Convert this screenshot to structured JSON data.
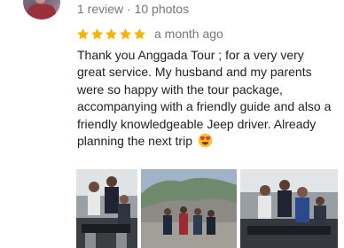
{
  "reviewer": {
    "avatar_icon": "user-avatar",
    "stats": "1 review · 10 photos"
  },
  "rating": {
    "stars": 5,
    "max": 5,
    "star_color": "#f4b400",
    "when": "a month ago"
  },
  "review": {
    "text": "Thank you Anggada Tour ; for a very very great service. My husband and my parents were so happy with the tour package, accompanying with a friendly guide and also a friendly knowledgeable Jeep driver. Already planning the next trip",
    "emoji_icon": "heart-eyes-emoji-icon"
  },
  "photos": [
    {
      "icon": "group-photo-jeep"
    },
    {
      "icon": "group-photo-mountain"
    },
    {
      "icon": "group-photo-jeep"
    }
  ]
}
